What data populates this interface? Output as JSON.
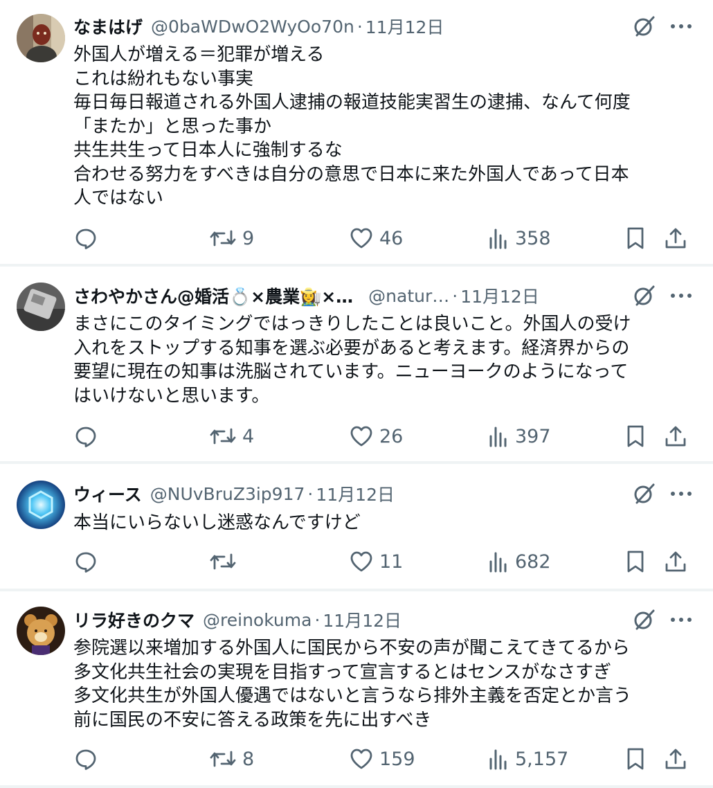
{
  "tweets": [
    {
      "name": "なまはげ",
      "handle": "@0baWDwO2WyOo70n",
      "date": "11月12日",
      "text": "外国人が増える＝犯罪が増える\nこれは紛れもない事実\n毎日毎日報道される外国人逮捕の報道技能実習生の逮捕、なんて何度\n「またか」と思った事か\n共生共生って日本人に強制するな\n合わせる努力をすべきは自分の意思で日本に来た外国人であって日本\n人ではない",
      "replies": "",
      "retweets": "9",
      "likes": "46",
      "views": "358"
    },
    {
      "name": "さわやかさん@婚活💍×農業👩‍🌾×…",
      "handle": "@natur…",
      "date": "11月12日",
      "text": "まさにこのタイミングではっきりしたことは良いこと。外国人の受け\n入れをストップする知事を選ぶ必要があると考えます。経済界からの\n要望に現在の知事は洗脳されています。ニューヨークのようになって\nはいけないと思います。",
      "replies": "",
      "retweets": "4",
      "likes": "26",
      "views": "397"
    },
    {
      "name": "ウィース",
      "handle": "@NUvBruZ3ip917",
      "date": "11月12日",
      "text": "本当にいらないし迷惑なんですけど",
      "replies": "",
      "retweets": "",
      "likes": "11",
      "views": "682"
    },
    {
      "name": "リラ好きのクマ",
      "handle": "@reinokuma",
      "date": "11月12日",
      "text": "参院選以来増加する外国人に国民から不安の声が聞こえてきてるから\n多文化共生社会の実現を目指すって宣言するとはセンスがなさすぎ\n多文化共生が外国人優遇ではないと言うなら排外主義を否定とか言う\n前に国民の不安に答える政策を先に出すべき",
      "replies": "",
      "retweets": "8",
      "likes": "159",
      "views": "5,157"
    }
  ],
  "separator": "·",
  "colors": {
    "text": "#0f1419",
    "secondary": "#536471",
    "divider": "#eff3f4"
  },
  "icons": [
    "reply-icon",
    "retweet-icon",
    "like-icon",
    "views-icon",
    "bookmark-icon",
    "share-icon",
    "grok-icon",
    "more-icon"
  ]
}
